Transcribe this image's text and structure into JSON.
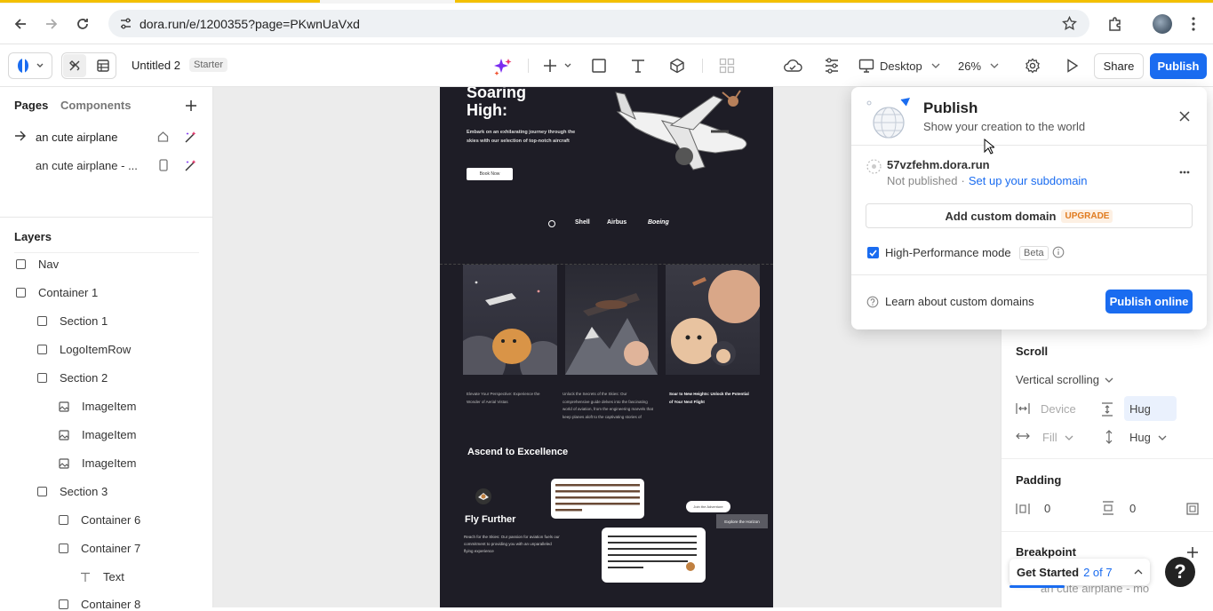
{
  "browser": {
    "url": "dora.run/e/1200355?page=PKwnUaVxd"
  },
  "toolbar": {
    "project_name": "Untitled 2",
    "plan_badge": "Starter",
    "device": "Desktop",
    "zoom": "26%",
    "share_label": "Share",
    "publish_label": "Publish"
  },
  "left_panel": {
    "tabs": [
      "Pages",
      "Components"
    ],
    "pages": [
      {
        "label": "an cute airplane"
      },
      {
        "label": "an cute airplane - ..."
      }
    ],
    "layers_title": "Layers",
    "layers": [
      {
        "label": "Nav",
        "icon": "checkbox"
      },
      {
        "label": "Container 1",
        "icon": "checkbox"
      },
      {
        "label": "Section 1",
        "icon": "checkbox"
      },
      {
        "label": "LogoItemRow",
        "icon": "checkbox"
      },
      {
        "label": "Section 2",
        "icon": "checkbox"
      },
      {
        "label": "ImageItem",
        "icon": "image"
      },
      {
        "label": "ImageItem",
        "icon": "image"
      },
      {
        "label": "ImageItem",
        "icon": "image"
      },
      {
        "label": "Section 3",
        "icon": "checkbox"
      },
      {
        "label": "Container 6",
        "icon": "checkbox"
      },
      {
        "label": "Container 7",
        "icon": "checkbox"
      },
      {
        "label": "Text",
        "icon": "text"
      },
      {
        "label": "Container 8",
        "icon": "checkbox"
      }
    ]
  },
  "canvas": {
    "hero_title_1": "Soaring",
    "hero_title_2": "High:",
    "hero_text": "Embark on an exhilarating journey through the skies with our selection of top-notch aircraft",
    "book_now": "Book Now",
    "logos": [
      "Shell",
      "Airbus",
      "Boeing"
    ],
    "card_captions": [
      "Elevate Your Perspective: Experience the Wonder of Aerial Vistas",
      "Unlock the Secrets of the Skies: Our comprehensive guide delves into the fascinating world of aviation, from the engineering marvels that keep planes aloft to the captivating stories of",
      "Soar to New Heights: Unlock the Potential of Your Next Flight"
    ],
    "section_title": "Ascend to Excellence",
    "fly_title": "Fly Further",
    "fly_text": "Reach for the Skies: Our passion for aviation fuels our commitment to providing you with an unparalleled flying experience",
    "join_adventure": "Join the Adventure",
    "explore_horizon": "Explore the Horizon"
  },
  "publish_popover": {
    "title": "Publish",
    "subtitle": "Show your creation to the world",
    "domain": "57vzfehm.dora.run",
    "status": "Not published",
    "status_separator": "·",
    "setup_link": "Set up your subdomain",
    "custom_domain_label": "Add custom domain",
    "upgrade_badge": "UPGRADE",
    "hp_mode_label": "High-Performance mode",
    "beta_badge": "Beta",
    "learn_link": "Learn about custom domains",
    "publish_online": "Publish online"
  },
  "right_panel": {
    "scroll_title": "Scroll",
    "scroll_value": "Vertical scrolling",
    "device_label": "Device",
    "hug1": "Hug",
    "fill_label": "Fill",
    "hug2": "Hug",
    "padding_title": "Padding",
    "padding_h": "0",
    "padding_v": "0",
    "breakpoint_title": "Breakpoint",
    "breakpoint_value": "an cute airplane - mo"
  },
  "get_started": {
    "label": "Get Started",
    "progress": "2 of 7"
  },
  "help": "?",
  "colors": {
    "accent": "#1a6cf0",
    "canvas_bg": "#1e1d26",
    "upgrade": "#e07b1f"
  }
}
